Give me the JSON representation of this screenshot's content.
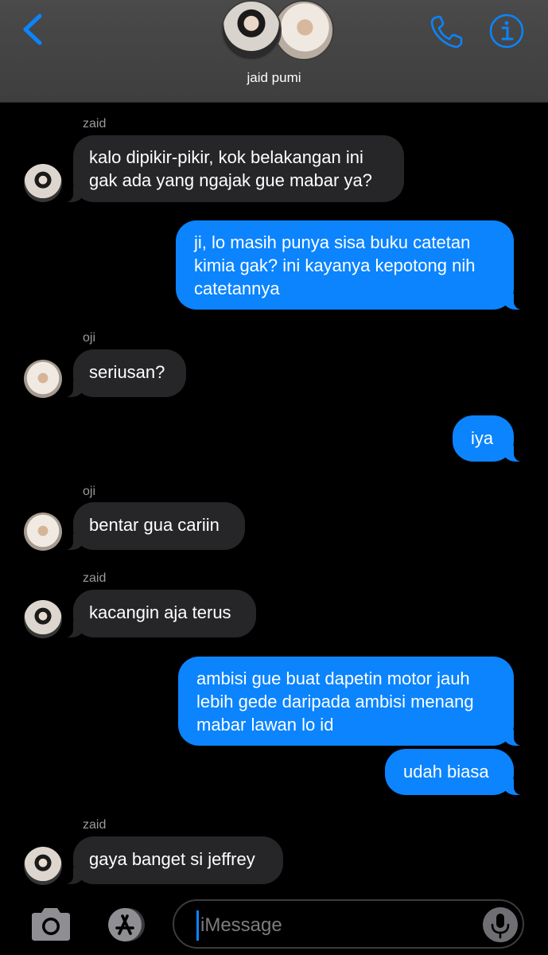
{
  "header": {
    "group_name": "jaid pumi",
    "icons": {
      "back": "chevron-left-icon",
      "call": "phone-icon",
      "info": "info-icon"
    },
    "accent_color": "#0b84fe"
  },
  "messages": [
    {
      "sender": "zaid",
      "direction": "incoming",
      "lines": [
        "kalo dipikir-pikir, kok belakangan ini",
        "gak ada yang ngajak gue mabar ya?"
      ]
    },
    {
      "direction": "outgoing",
      "lines": [
        "ji, lo masih punya sisa buku catetan",
        "kimia gak? ini kayanya kepotong nih",
        "catetannya"
      ]
    },
    {
      "sender": "oji",
      "direction": "incoming",
      "lines": [
        "seriusan?"
      ]
    },
    {
      "direction": "outgoing",
      "lines": [
        "iya"
      ]
    },
    {
      "sender": "oji",
      "direction": "incoming",
      "lines": [
        "bentar gua cariin"
      ]
    },
    {
      "sender": "zaid",
      "direction": "incoming",
      "lines": [
        "kacangin aja terus"
      ]
    },
    {
      "direction": "outgoing",
      "lines": [
        "ambisi gue buat dapetin motor jauh",
        "lebih gede daripada ambisi menang",
        "mabar lawan lo id"
      ]
    },
    {
      "direction": "outgoing",
      "lines": [
        "udah biasa"
      ]
    },
    {
      "sender": "zaid",
      "direction": "incoming",
      "lines": [
        "gaya banget si jeffrey"
      ]
    }
  ],
  "composer": {
    "placeholder": "iMessage",
    "icons": {
      "camera": "camera-icon",
      "apps": "app-store-icon",
      "mic": "microphone-icon"
    }
  },
  "colors": {
    "incoming_bubble": "#262629",
    "outgoing_bubble": "#0b84fe",
    "background": "#000000"
  }
}
